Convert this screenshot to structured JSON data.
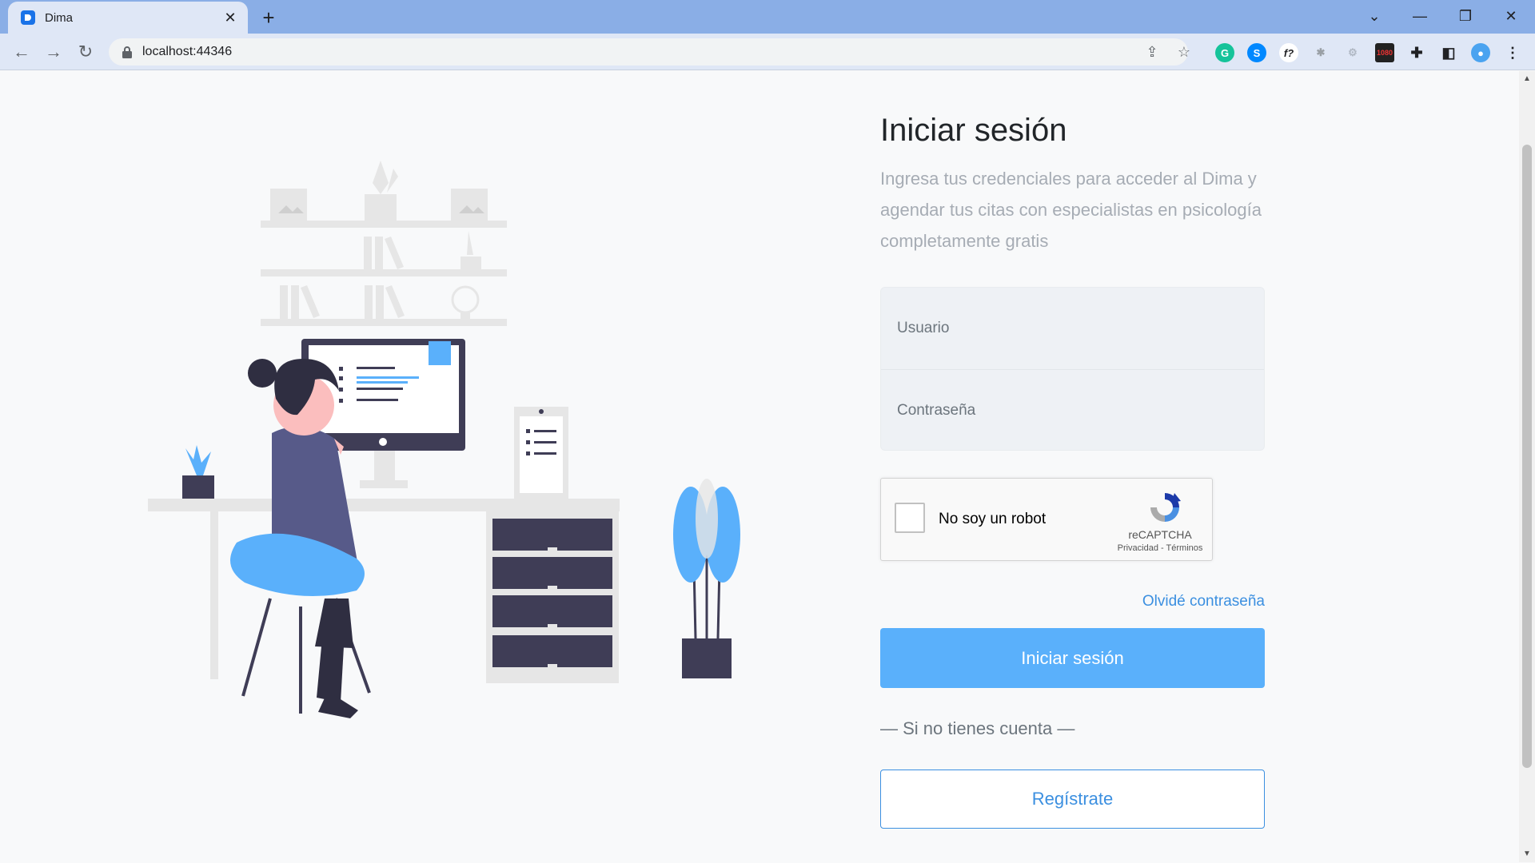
{
  "browser": {
    "tab_title": "Dima",
    "url": "localhost:44346",
    "new_tab_icon": "plus-icon",
    "extensions": [
      "grammarly-icon",
      "shazam-icon",
      "fontface-icon",
      "bug-icon",
      "settings-icon",
      "resolution-icon",
      "puzzle-icon",
      "sidepanel-icon",
      "profile-icon"
    ]
  },
  "login": {
    "title": "Iniciar sesión",
    "subtitle": "Ingresa tus credenciales para acceder al Dima y agendar tus citas con especialistas en psicología completamente gratis",
    "username_placeholder": "Usuario",
    "password_placeholder": "Contraseña",
    "captcha_label": "No soy un robot",
    "captcha_brand": "reCAPTCHA",
    "captcha_links": "Privacidad - Términos",
    "forgot_password": "Olvidé contraseña",
    "submit_label": "Iniciar sesión",
    "no_account": "— Si no tienes cuenta —",
    "register_label": "Regístrate"
  },
  "colors": {
    "primary": "#5ab0fb",
    "link": "#3b8fe0",
    "illustration_accent": "#5ab0fb",
    "illustration_dark": "#3f3d56"
  }
}
